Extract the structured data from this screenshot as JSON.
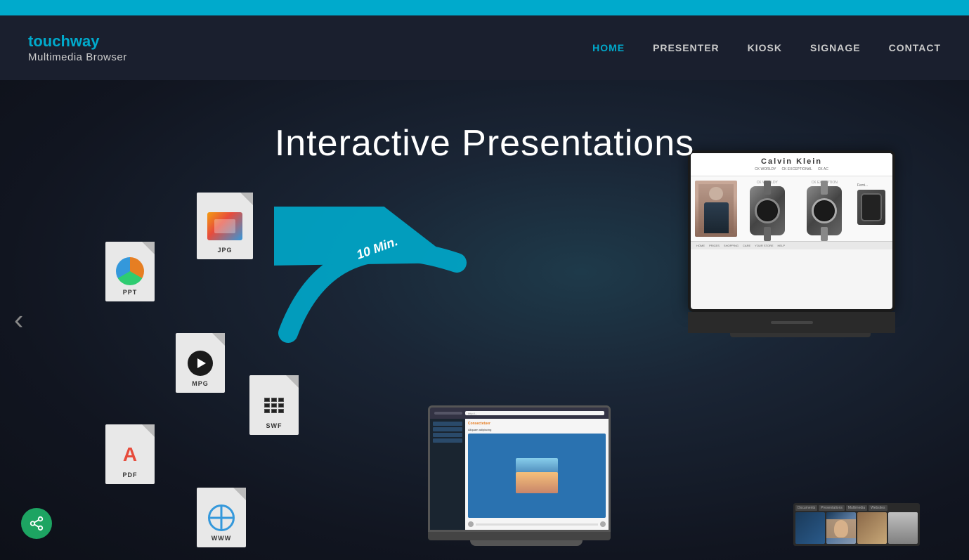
{
  "topbar": {},
  "header": {
    "logo_brand_part1": "touch",
    "logo_brand_part2": "way",
    "logo_sub": "Multimedia Browser"
  },
  "nav": {
    "items": [
      {
        "label": "HOME",
        "active": true
      },
      {
        "label": "PRESENTER",
        "active": false
      },
      {
        "label": "KIOSK",
        "active": false
      },
      {
        "label": "SIGNAGE",
        "active": false
      },
      {
        "label": "CONTACT",
        "active": false
      }
    ]
  },
  "hero": {
    "title": "Interactive Presentations",
    "arrow_label": "10 Min.",
    "file_types": [
      "JPG",
      "PPT",
      "MPG",
      "SWF",
      "PDF",
      "WWW"
    ]
  },
  "screen": {
    "brand": "Calvin Klein",
    "nav_items": [
      "CK WORLDY",
      "CK EXCEPTIONAL",
      "CK AC"
    ],
    "product_label_left": "Femi..."
  },
  "bottom_nav": {
    "tabs": [
      "Documents",
      "Presentations",
      "Multimedia",
      "Websites"
    ]
  }
}
